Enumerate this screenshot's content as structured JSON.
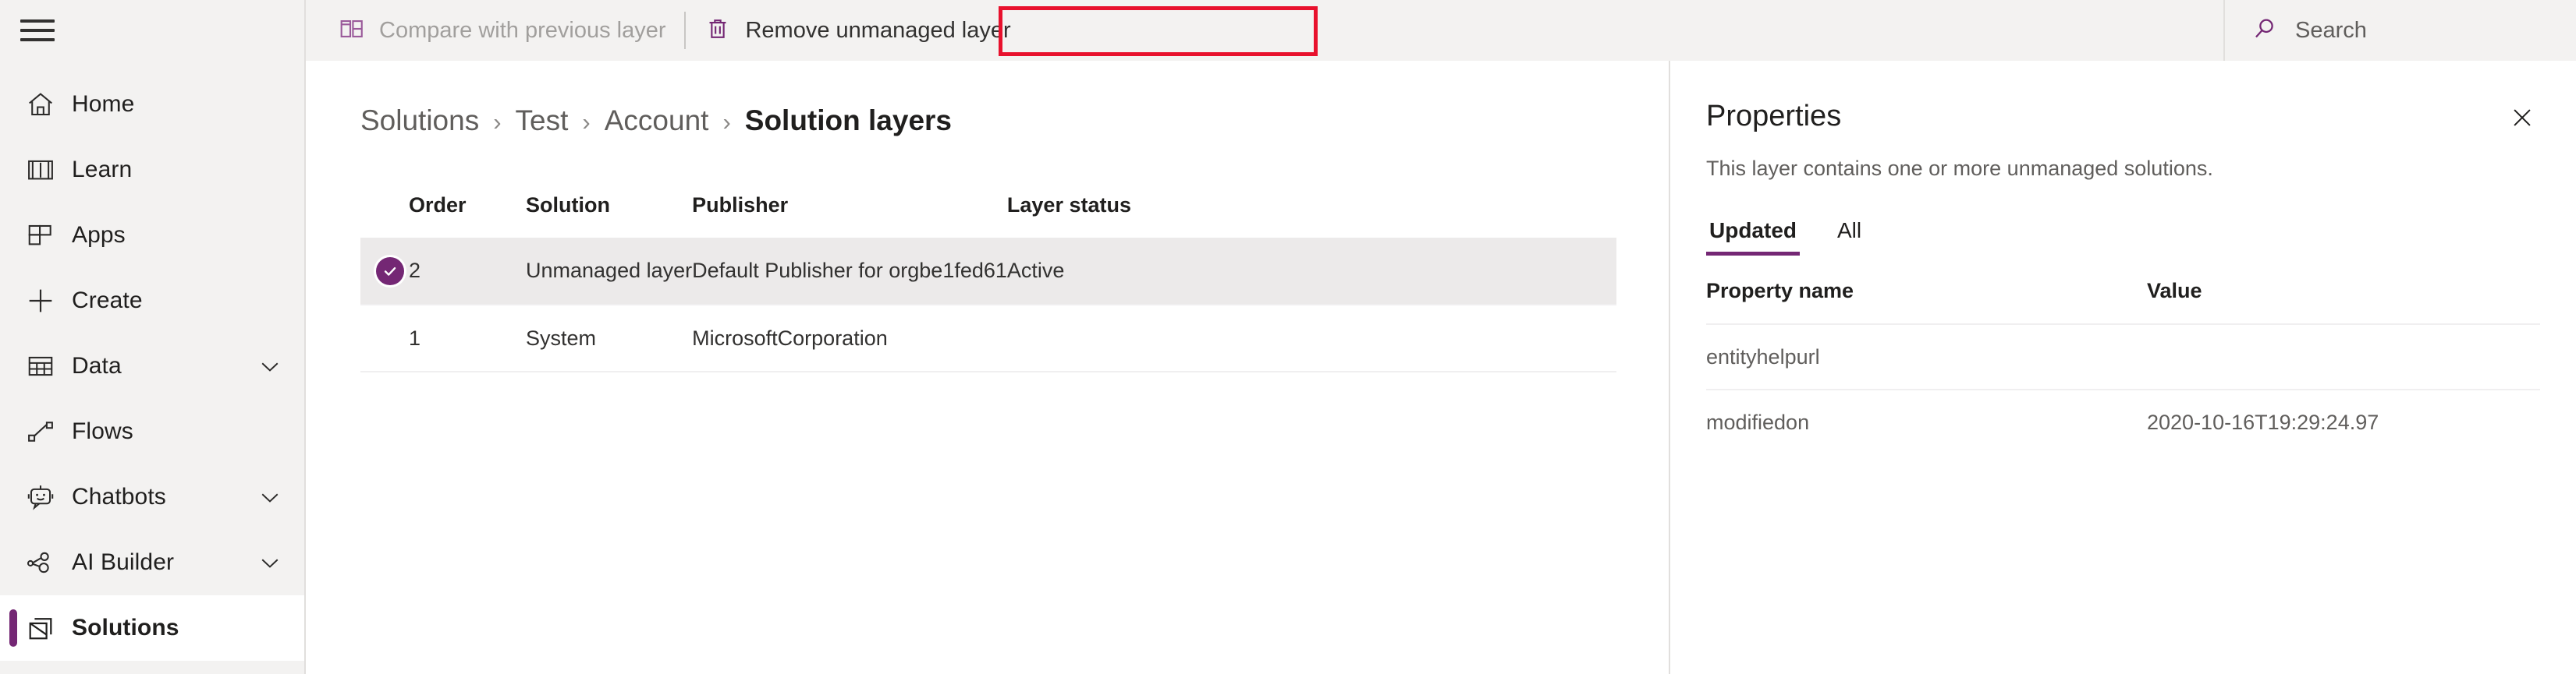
{
  "sidebar": {
    "menu_icon": "hamburger-icon",
    "items": [
      {
        "label": "Home",
        "icon": "home-icon",
        "has_chevron": false,
        "active": false
      },
      {
        "label": "Learn",
        "icon": "book-icon",
        "has_chevron": false,
        "active": false
      },
      {
        "label": "Apps",
        "icon": "apps-grid-icon",
        "has_chevron": false,
        "active": false
      },
      {
        "label": "Create",
        "icon": "plus-icon",
        "has_chevron": false,
        "active": false
      },
      {
        "label": "Data",
        "icon": "table-icon",
        "has_chevron": true,
        "active": false
      },
      {
        "label": "Flows",
        "icon": "flows-icon",
        "has_chevron": false,
        "active": false
      },
      {
        "label": "Chatbots",
        "icon": "chatbot-icon",
        "has_chevron": true,
        "active": false
      },
      {
        "label": "AI Builder",
        "icon": "ai-builder-icon",
        "has_chevron": true,
        "active": false
      },
      {
        "label": "Solutions",
        "icon": "solutions-icon",
        "has_chevron": false,
        "active": true
      }
    ]
  },
  "command_bar": {
    "compare_label": "Compare with previous layer",
    "compare_icon": "compare-layers-icon",
    "remove_label": "Remove unmanaged layer",
    "remove_icon": "trash-icon",
    "highlight_color": "#e8112d"
  },
  "search": {
    "label": "Search",
    "icon": "search-icon"
  },
  "breadcrumb": {
    "items": [
      "Solutions",
      "Test",
      "Account"
    ],
    "current": "Solution layers",
    "separator": "›"
  },
  "layers_table": {
    "columns": [
      "Order",
      "Solution",
      "Publisher",
      "Layer status"
    ],
    "rows": [
      {
        "selected": true,
        "order": "2",
        "solution": "Unmanaged layer",
        "publisher": "Default Publisher for orgbe1fed61",
        "layer_status": "Active"
      },
      {
        "selected": false,
        "order": "1",
        "solution": "System",
        "publisher": "MicrosoftCorporation",
        "layer_status": ""
      }
    ]
  },
  "properties": {
    "title": "Properties",
    "subtitle": "This layer contains one or more unmanaged solutions.",
    "close_icon": "close-icon",
    "tabs": [
      {
        "label": "Updated",
        "active": true
      },
      {
        "label": "All",
        "active": false
      }
    ],
    "columns": [
      "Property name",
      "Value"
    ],
    "rows": [
      {
        "name": "entityhelpurl",
        "value": ""
      },
      {
        "name": "modifiedon",
        "value": "2020-10-16T19:29:24.97"
      }
    ]
  },
  "theme": {
    "accent": "#742774",
    "sidebar_bg": "#f3f2f1",
    "content_bg": "#ffffff",
    "selected_row_bg": "#eceaea",
    "text_primary": "#201f1e",
    "text_secondary": "#605e5c",
    "text_disabled": "#a19f9d"
  }
}
